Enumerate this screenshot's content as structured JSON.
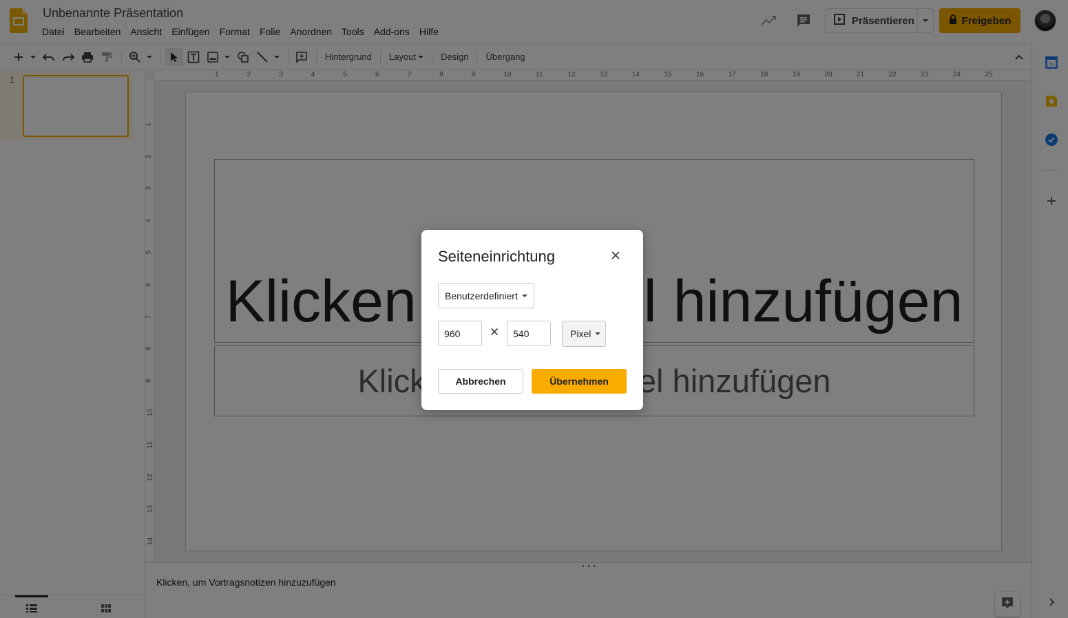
{
  "app": {
    "title": "Unbenannte Präsentation",
    "accent_color": "#f9ab00"
  },
  "menu": [
    "Datei",
    "Bearbeiten",
    "Ansicht",
    "Einfügen",
    "Format",
    "Folie",
    "Anordnen",
    "Tools",
    "Add-ons",
    "Hilfe"
  ],
  "header": {
    "present_label": "Präsentieren",
    "share_label": "Freigeben"
  },
  "toolbar": {
    "background_label": "Hintergrund",
    "layout_label": "Layout",
    "design_label": "Design",
    "transition_label": "Übergang"
  },
  "filmstrip": {
    "slides": [
      {
        "number": "1"
      }
    ]
  },
  "ruler": {
    "horizontal": [
      "1",
      "2",
      "3",
      "4",
      "5",
      "6",
      "7",
      "8",
      "9",
      "10",
      "11",
      "12",
      "13",
      "14",
      "15",
      "16",
      "17",
      "18",
      "19",
      "20",
      "21",
      "22",
      "23",
      "24",
      "25"
    ],
    "vertical": [
      "1",
      "2",
      "3",
      "4",
      "5",
      "6",
      "7",
      "8",
      "9",
      "10",
      "11",
      "12",
      "13",
      "14"
    ]
  },
  "slide": {
    "title_placeholder": "Klicken, um Titel hinzufügen",
    "subtitle_placeholder": "Klicken, um Untertitel hinzufügen"
  },
  "notes": {
    "placeholder": "Klicken, um Vortragsnotizen hinzuzufügen"
  },
  "dialog": {
    "title": "Seiteneinrichtung",
    "preset_label": "Benutzerdefiniert",
    "width_value": "960",
    "height_value": "540",
    "unit_label": "Pixel",
    "cancel_label": "Abbrechen",
    "apply_label": "Übernehmen"
  }
}
